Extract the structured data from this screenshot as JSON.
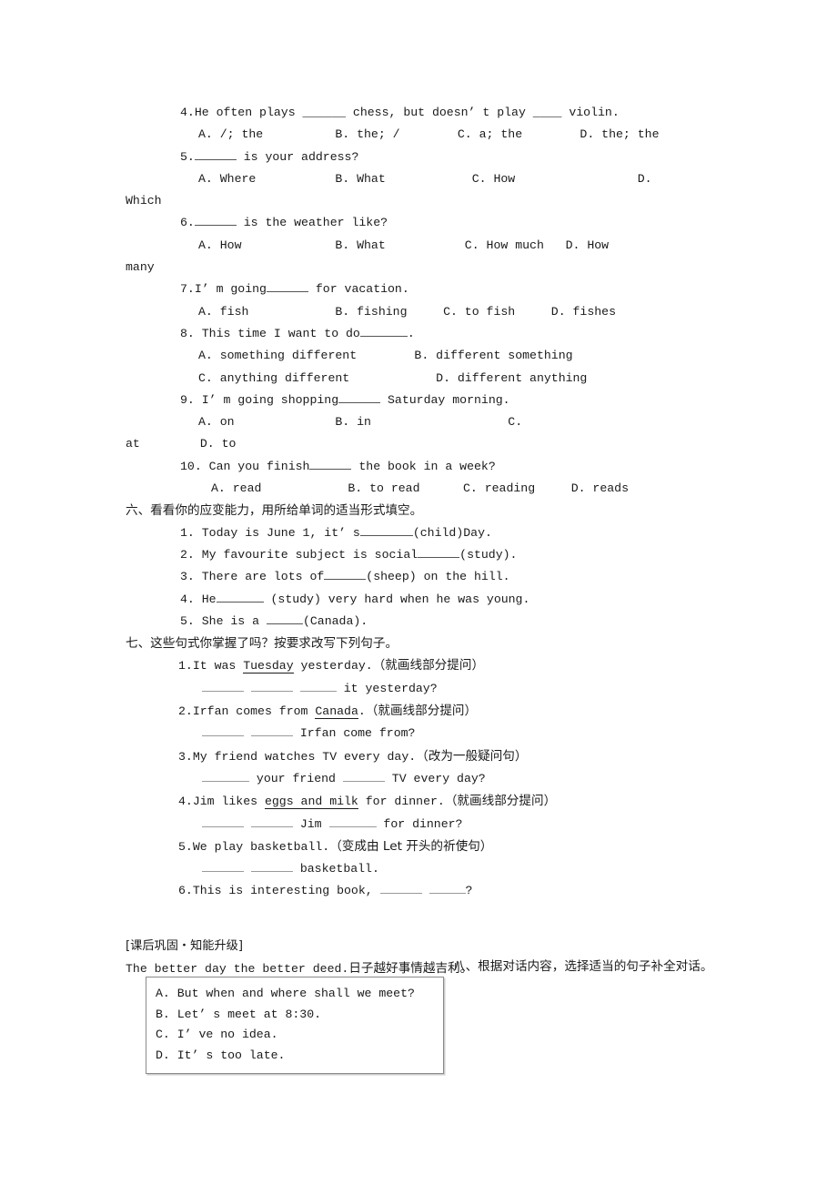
{
  "document": {
    "type": "english-exercise-worksheet",
    "language": "zh-CN/en"
  },
  "multiple_choice_continued": {
    "q4": {
      "stem": "4.He often plays ______ chess, but doesn’ t play ____ violin.",
      "options_line": "A. /; the          B. the; /        C. a; the        D. the; the"
    },
    "q5": {
      "stem_prefix": "5.",
      "stem_suffix": " is your address?",
      "options_line": "A. Where           B. What            C. How                 D.",
      "overflow": "Which"
    },
    "q6": {
      "stem_prefix": "6.",
      "stem_suffix": " is the weather like?",
      "options_line": "A. How             B. What           C. How much   D. How",
      "overflow": "many"
    },
    "q7": {
      "stem_before": "7.I’ m going",
      "stem_after": " for vacation.",
      "options_line": "A. fish            B. fishing     C. to fish     D. fishes"
    },
    "q8": {
      "stem_before": "8. This time I want to do",
      "stem_after": ".",
      "options_line_1": "A. something different        B. different something",
      "options_line_2": "C. anything different            D. different anything"
    },
    "q9": {
      "stem_before": "9. I’ m going shopping",
      "stem_after": " Saturday morning.",
      "options_line": "A. on              B. in                   C.",
      "overflow": "at",
      "options_line_2": "D. to"
    },
    "q10": {
      "stem_before": "10. Can you finish",
      "stem_after": " the book in a week?",
      "options_line": "A. read            B. to read      C. reading     D. reads"
    }
  },
  "section_six": {
    "heading": "六、看看你的应变能力，用所给单词的适当形式填空。",
    "items": [
      {
        "before": "1. Today is June 1, it’ s",
        "after": "(child)Day."
      },
      {
        "before": "2. My favourite subject is social",
        "after": "(study)."
      },
      {
        "before": "3. There are lots of",
        "after": "(sheep) on the hill."
      },
      {
        "before": "4. He",
        "after": " (study) very hard when he was young."
      },
      {
        "before": "5. She is a ",
        "after": "(Canada)."
      }
    ]
  },
  "section_seven": {
    "heading": "七、这些句式你掌握了吗？按要求改写下列句子。",
    "items": [
      {
        "number": "1.",
        "stem_before": "It was ",
        "stem_underlined": "Tuesday",
        "stem_after": " yesterday.",
        "instruction": "（就画线部分提问）",
        "answer_blanks": 3,
        "answer_tail": " it yesterday?"
      },
      {
        "number": "2.",
        "stem_before": "Irfan comes from ",
        "stem_underlined": "Canada",
        "stem_after": ".",
        "instruction": "（就画线部分提问）",
        "answer_blanks": 2,
        "answer_tail": " Irfan come from?"
      },
      {
        "number": "3.",
        "stem_before": "My friend watches TV every day.",
        "stem_underlined": "",
        "stem_after": "",
        "instruction": "（改为一般疑问句）",
        "answer_blanks": 2,
        "answer_tail": " your friend ______ TV every day?"
      },
      {
        "number": "4.",
        "stem_before": "Jim likes ",
        "stem_underlined": "eggs and milk",
        "stem_after": " for dinner.",
        "instruction": "（就画线部分提问）",
        "answer_blanks": 2,
        "answer_tail": " Jim ______ for dinner?"
      },
      {
        "number": "5.",
        "stem_before": "We play basketball.",
        "stem_underlined": "",
        "stem_after": "",
        "instruction": "（变成由 Let 开头的祈使句）",
        "answer_blanks": 2,
        "answer_tail": " basketball."
      },
      {
        "number": "6.",
        "stem_before": "This is interesting book, ",
        "stem_underlined": "",
        "stem_after": "",
        "instruction": "",
        "answer_blanks": 2,
        "answer_tail": "?"
      }
    ]
  },
  "footer": {
    "bracket_title": "[课后巩固・知能升级]",
    "proverb_en": "The better day the better deed.",
    "proverb_cn": "日子越好事情越吉利。"
  },
  "section_eight": {
    "heading": "八、根据对话内容，选择适当的句子补全对话。",
    "choices": [
      "A. But when and where shall we meet?",
      "B. Let’ s meet at 8:30.",
      "C. I’ ve no idea.",
      "D. It’ s too late."
    ]
  }
}
